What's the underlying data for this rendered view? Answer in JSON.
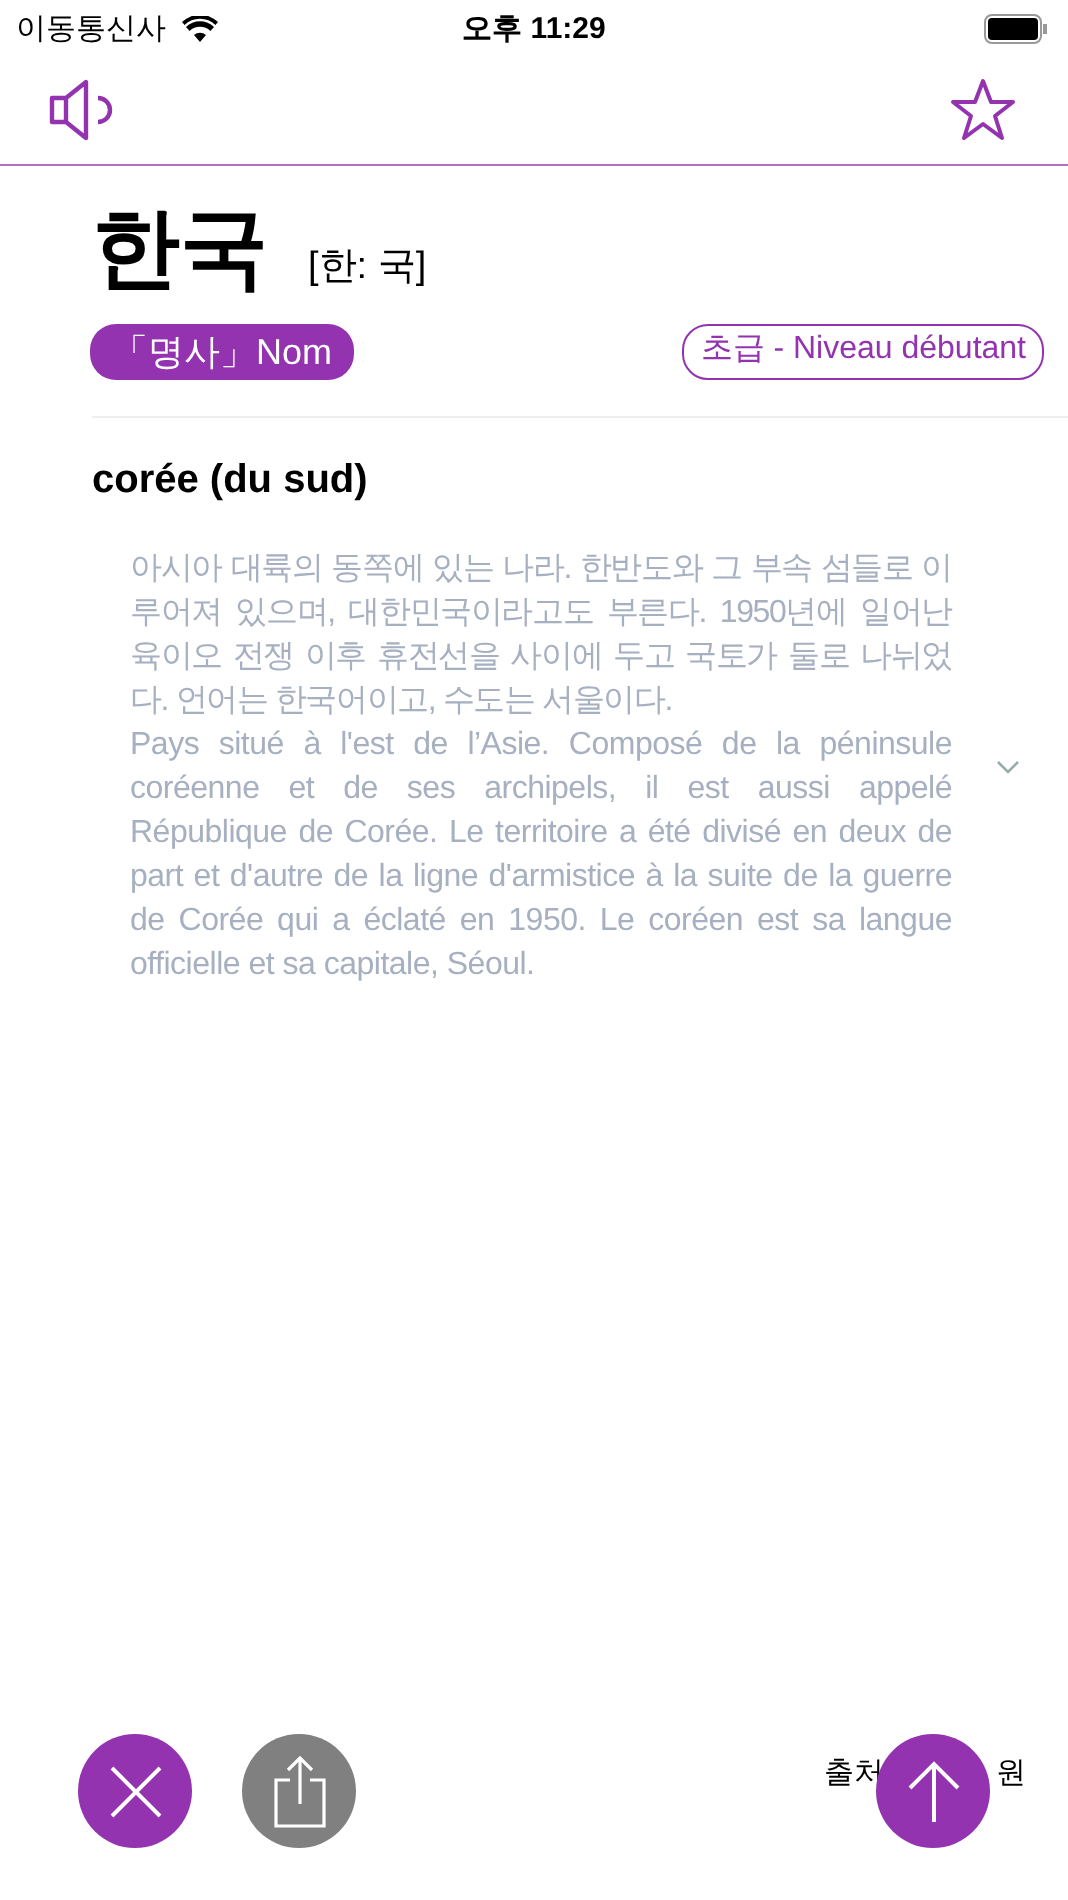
{
  "status_bar": {
    "carrier": "이동통신사",
    "time": "오후 11:29"
  },
  "entry": {
    "word": "한국",
    "pronunciation": "[한: 국]",
    "part_of_speech": "「명사」Nom",
    "level": "초급 - Niveau débutant"
  },
  "definitions": [
    {
      "title": "corée (du sud)",
      "korean": "아시아 대륙의 동쪽에 있는 나라. 한반도와 그 부속 섬들로 이루어져 있으며, 대한민국이라고도 부른다. 1950년에 일어난 육이오 전쟁 이후 휴전선을 사이에 두고 국토가 둘로 나뉘었다. 언어는 한국어이고, 수도는 서울이다.",
      "french": "Pays situé à l'est de l’Asie. Composé de la péninsule coréenne et de ses archipels, il est aussi appelé République de Corée. Le territoire a été divisé en deux de part et d'autre de la ligne d'armistice à la suite de la guerre de Corée qui a éclaté en 1950. Le coréen est sa langue officielle et sa capitale, Séoul.",
      "expanded": false
    }
  ],
  "footer": {
    "source_start": "출처",
    "source_end": "원"
  }
}
